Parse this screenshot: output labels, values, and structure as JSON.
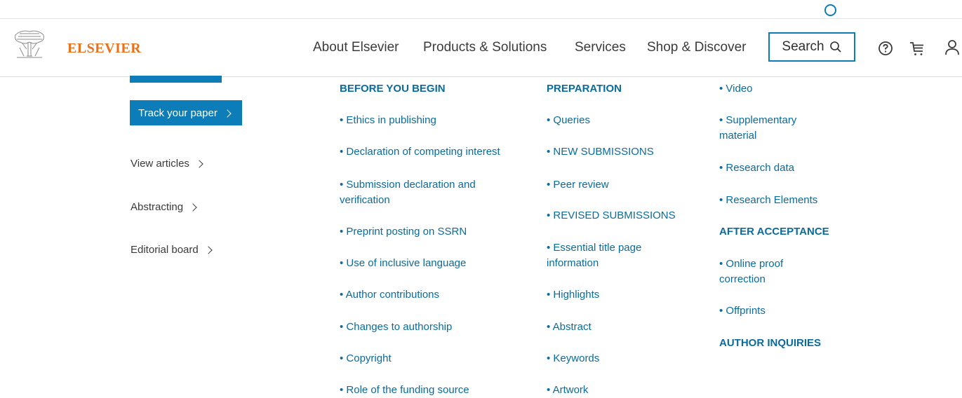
{
  "header": {
    "brand": "ELSEVIER",
    "nav": [
      "About Elsevier",
      "Products & Solutions",
      "Services",
      "Shop & Discover"
    ],
    "search_label": "Search"
  },
  "sidebar": {
    "track_label": "Track your paper",
    "links": [
      "View articles",
      "Abstracting",
      "Editorial board"
    ]
  },
  "guide": {
    "col1": {
      "heading": "BEFORE YOU BEGIN",
      "items": [
        "• Ethics in publishing",
        "• Declaration of competing interest",
        "• Submission declaration and verification",
        "• Preprint posting on SSRN",
        "• Use of inclusive language",
        "• Author contributions",
        "• Changes to authorship",
        "• Copyright",
        "• Role of the funding source"
      ]
    },
    "col2": {
      "heading": "PREPARATION",
      "items": [
        "• Queries",
        "• NEW SUBMISSIONS",
        "• Peer review",
        "• REVISED SUBMISSIONS",
        "• Essential title page information",
        "• Highlights",
        "• Abstract",
        "• Keywords",
        "• Artwork"
      ]
    },
    "col3": {
      "items_top": [
        "• Video",
        "• Supplementary material",
        "• Research data",
        "• Research Elements"
      ],
      "after_heading": "AFTER ACCEPTANCE",
      "after_items": [
        "• Online proof correction",
        "• Offprints"
      ],
      "inquiries_heading": "AUTHOR INQUIRIES"
    }
  },
  "colors": {
    "accent": "#0c7db8",
    "link": "#0a6b9c",
    "brand": "#e9711c"
  }
}
